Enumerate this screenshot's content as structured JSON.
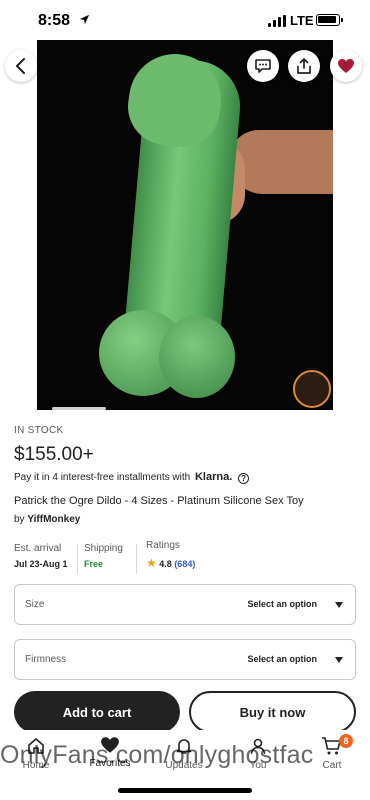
{
  "status_bar": {
    "time": "8:58",
    "network": "LTE"
  },
  "hero": {
    "image_alt": "product photo",
    "buttons": {
      "back_icon": "chevron-left-icon",
      "message_icon": "message-icon",
      "share_icon": "share-icon",
      "favorite_icon": "heart-icon"
    },
    "favorite_color": "#a61a3a"
  },
  "product": {
    "stock_status": "IN STOCK",
    "price": "$155.00+",
    "installments_text": "Pay it in 4 interest-free installments with",
    "installments_brand": "Klarna.",
    "title": "Patrick the Ogre Dildo - 4 Sizes - Platinum Silicone Sex Toy",
    "seller_prefix": "by",
    "seller_name": "YiffMonkey"
  },
  "stats": {
    "arrival_label": "Est. arrival",
    "arrival_value": "Jul 23-Aug 1",
    "shipping_label": "Shipping",
    "shipping_value": "Free",
    "shipping_color": "#258635",
    "ratings_label": "Ratings",
    "rating_value": "4.8",
    "rating_count": "(684)"
  },
  "options": [
    {
      "label": "Size",
      "value": "Select an option"
    },
    {
      "label": "Firmness",
      "value": "Select an option"
    }
  ],
  "actions": {
    "add_to_cart": "Add to cart",
    "buy_now": "Buy it now"
  },
  "tabbar": {
    "items": [
      {
        "label": "Home",
        "icon": "home-icon"
      },
      {
        "label": "Favorites",
        "icon": "heart-icon"
      },
      {
        "label": "Updates",
        "icon": "bell-icon"
      },
      {
        "label": "You",
        "icon": "person-icon"
      },
      {
        "label": "Cart",
        "icon": "cart-icon"
      }
    ],
    "cart_count": "8",
    "badge_color": "#f1641e"
  },
  "watermark": "OnlyFans.com/onlyghostfac"
}
